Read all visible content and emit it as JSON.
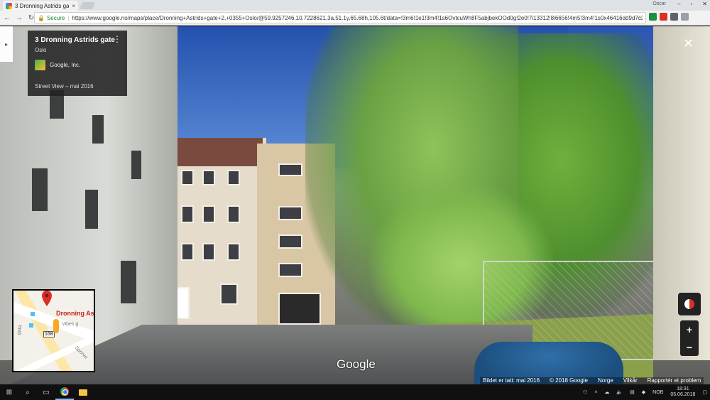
{
  "browser": {
    "tab_title": "3 Dronning Astrids gate",
    "tab_close": "×",
    "profile_name": "Oscar",
    "window_controls": [
      "–",
      "▫",
      "✕"
    ],
    "nav": {
      "back": "←",
      "forward": "→",
      "reload": "↻"
    },
    "secure_label": "Secure",
    "url": "https://www.google.no/maps/place/Dronning+Astrids+gate+2,+0355+Oslo/@59.9257246,10.7228621,3a,51.1y,65.68h,105.6t/data=!3m6!1e1!3m4!1s6OvtcuWh8F5abjbekOOd0g!2e0!7i13312!8i6656!4m5!3m4!1s0x46416dd9d7c2c1",
    "bookmark_icon": "star-icon"
  },
  "info_card": {
    "place_name": "3 Dronning Astrids gate",
    "city": "Oslo",
    "owner": "Google, Inc.",
    "capture": "Street View – mai 2016",
    "more_icon": "⋮"
  },
  "close_label": "✕",
  "expand_label": "▸",
  "minimap": {
    "place_label": "Dronning Astr",
    "street_label_1": "Vibes g",
    "street_label_2": "gata",
    "street_label_3": "Sporve",
    "road_number": "168"
  },
  "zoom": {
    "in": "+",
    "out": "−"
  },
  "logo_text": "Google",
  "attribution": {
    "capture_date": "Bildet er tatt: mai 2016",
    "copyright": "© 2018 Google",
    "region": "Norge",
    "terms": "Vilkår",
    "report": "Rapportér et problem"
  },
  "taskbar": {
    "language": "NOB",
    "time": "18:31",
    "date": "05.06.2018"
  },
  "colors": {
    "sky": "#2b56b3",
    "card_bg": "#222222",
    "secure_green": "#188038",
    "pin_red": "#c5221f"
  }
}
